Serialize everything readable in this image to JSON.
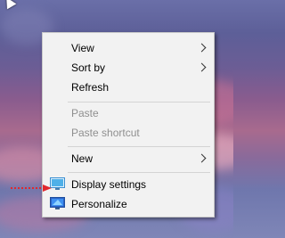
{
  "menu": {
    "items": [
      {
        "label": "View",
        "submenu": true,
        "enabled": true
      },
      {
        "label": "Sort by",
        "submenu": true,
        "enabled": true
      },
      {
        "label": "Refresh",
        "submenu": false,
        "enabled": true
      },
      {
        "label": "Paste",
        "submenu": false,
        "enabled": false
      },
      {
        "label": "Paste shortcut",
        "submenu": false,
        "enabled": false
      },
      {
        "label": "New",
        "submenu": true,
        "enabled": true
      },
      {
        "label": "Display settings",
        "submenu": false,
        "enabled": true,
        "icon": "display-settings-icon"
      },
      {
        "label": "Personalize",
        "submenu": false,
        "enabled": true,
        "icon": "personalize-icon"
      }
    ]
  },
  "colors": {
    "menu_background": "#f2f2f2",
    "disabled_text": "#8f8f8f",
    "annotation_arrow": "#e0282e"
  },
  "annotation": {
    "arrow": "red-dotted-arrow"
  }
}
